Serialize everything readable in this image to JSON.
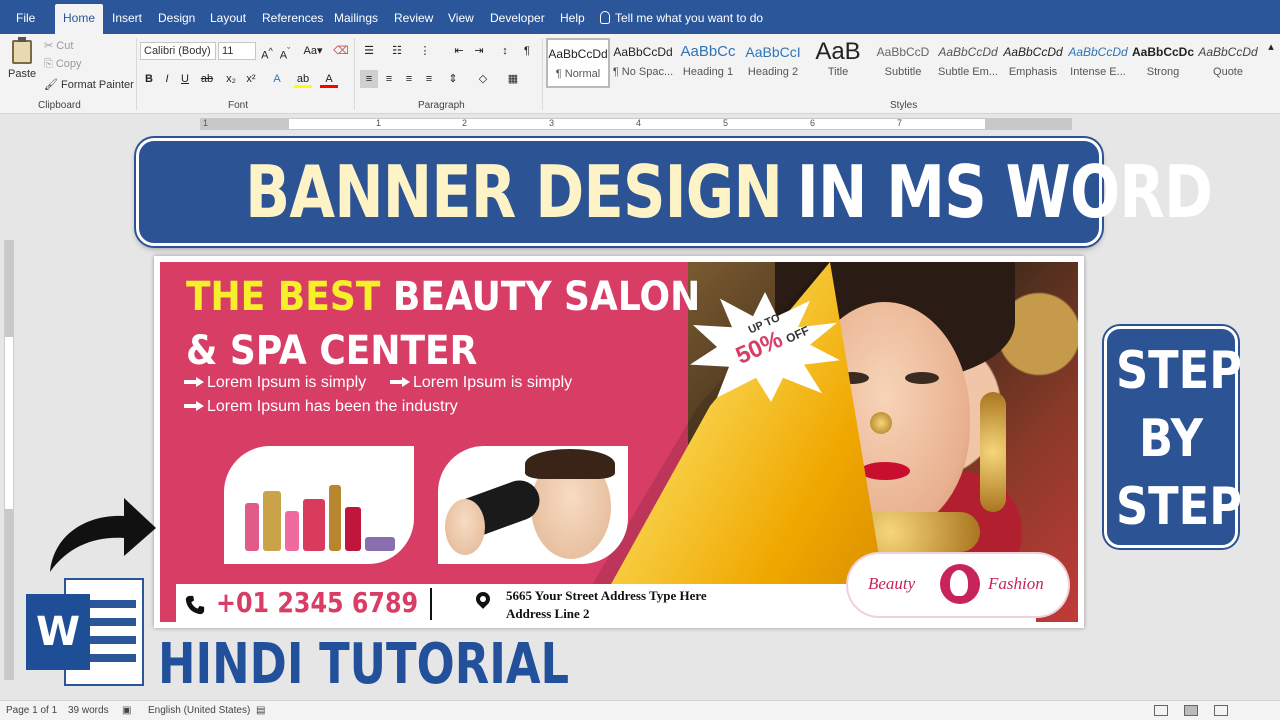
{
  "ribbon_tabs": [
    {
      "label": "File",
      "active": false
    },
    {
      "label": "Home",
      "active": true
    },
    {
      "label": "Insert",
      "active": false
    },
    {
      "label": "Design",
      "active": false
    },
    {
      "label": "Layout",
      "active": false
    },
    {
      "label": "References",
      "active": false
    },
    {
      "label": "Mailings",
      "active": false
    },
    {
      "label": "Review",
      "active": false
    },
    {
      "label": "View",
      "active": false
    },
    {
      "label": "Developer",
      "active": false
    },
    {
      "label": "Help",
      "active": false
    }
  ],
  "tell_me": "Tell me what you want to do",
  "clipboard": {
    "paste": "Paste",
    "cut": "Cut",
    "copy": "Copy",
    "format_painter": "Format Painter",
    "group_label": "Clipboard"
  },
  "font": {
    "family": "Calibri (Body)",
    "size": "11",
    "group_label": "Font",
    "bold": "B",
    "italic": "I",
    "underline": "U"
  },
  "paragraph": {
    "group_label": "Paragraph"
  },
  "styles": {
    "group_label": "Styles",
    "items": [
      {
        "sample": "AaBbCcDd",
        "name": "¶ Normal",
        "selected": true
      },
      {
        "sample": "AaBbCcDd",
        "name": "¶ No Spac...",
        "selected": false
      },
      {
        "sample": "AaBbCc",
        "name": "Heading 1",
        "selected": false
      },
      {
        "sample": "AaBbCcI",
        "name": "Heading 2",
        "selected": false
      },
      {
        "sample": "AaB",
        "name": "Title",
        "selected": false
      },
      {
        "sample": "AaBbCcD",
        "name": "Subtitle",
        "selected": false
      },
      {
        "sample": "AaBbCcDd",
        "name": "Subtle Em...",
        "selected": false
      },
      {
        "sample": "AaBbCcDd",
        "name": "Emphasis",
        "selected": false
      },
      {
        "sample": "AaBbCcDd",
        "name": "Intense E...",
        "selected": false
      },
      {
        "sample": "AaBbCcDc",
        "name": "Strong",
        "selected": false
      },
      {
        "sample": "AaBbCcDd",
        "name": "Quote",
        "selected": false
      }
    ]
  },
  "ruler_numbers": [
    "1",
    "1",
    "2",
    "3",
    "4",
    "5",
    "6",
    "7"
  ],
  "title_banner": {
    "part1": "BANNER DESIGN",
    "part2": "IN MS WORD"
  },
  "banner": {
    "headline_yellow": "THE BEST",
    "headline_white": "BEAUTY SALON",
    "headline_line2": "& SPA CENTER",
    "bullets": [
      "Lorem Ipsum is simply",
      "Lorem Ipsum is simply",
      "Lorem Ipsum has been the industry"
    ],
    "offer": {
      "upto": "UP TO",
      "percent": "50%",
      "off": "OFF"
    },
    "phone": "+01 2345 6789",
    "address_line1": "5665 Your Street Address Type Here",
    "address_line2": "Address Line 2",
    "logo_left": "Beauty",
    "logo_right": "Fashion"
  },
  "side_badge": [
    "STEP",
    "BY",
    "STEP"
  ],
  "word_logo_letter": "W",
  "footer_title": "HINDI TUTORIAL",
  "status": {
    "page": "Page 1 of 1",
    "words": "39 words",
    "language": "English (United States)"
  },
  "colors": {
    "word_blue": "#2b579a",
    "banner_pink": "#d83d66",
    "title_cream": "#fef3c7",
    "headline_yellow": "#f7ef2a"
  }
}
